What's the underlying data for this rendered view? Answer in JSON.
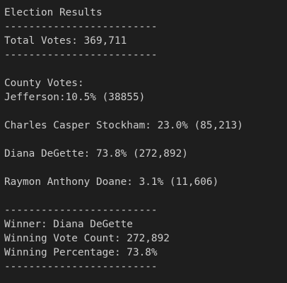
{
  "terminal": {
    "title": "Election Results",
    "divider": "-------------------------",
    "total_votes_line": "Total Votes: 369,711",
    "county_header": "County Votes:",
    "county_line": "Jefferson:10.5% (38855)",
    "candidates": [
      "Charles Casper Stockham: 23.0% (85,213)",
      "Diana DeGette: 73.8% (272,892)",
      "Raymon Anthony Doane: 3.1% (11,606)"
    ],
    "winner_line": "Winner: Diana DeGette",
    "winning_count_line": "Winning Vote Count: 272,892",
    "winning_percentage_line": "Winning Percentage: 73.8%"
  },
  "colors": {
    "background": "#1e1e1e",
    "text": "#cccccc"
  }
}
